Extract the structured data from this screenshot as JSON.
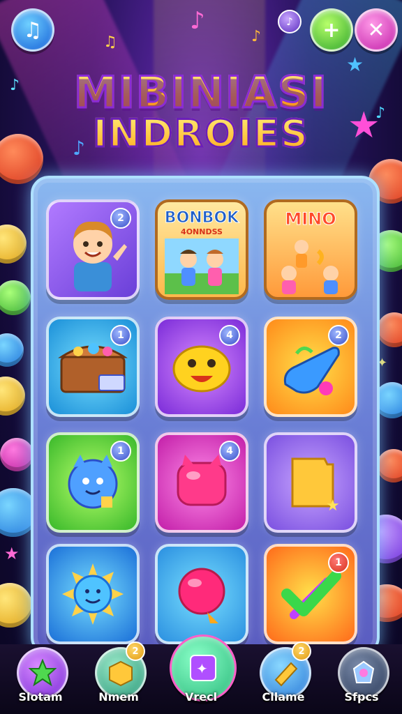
{
  "header": {
    "title_line1": "MIBINIASI",
    "title_line2": "INDROIES",
    "buttons": {
      "music_icon": "music-note-icon",
      "mini_icon": "music-note-icon",
      "plus_icon": "plus-icon",
      "close_icon": "close-icon",
      "music_glyph": "♫",
      "mini_glyph": "♪",
      "plus_glyph": "+",
      "close_glyph": "✕"
    }
  },
  "grid": {
    "tiles": [
      {
        "id": "boy",
        "badge": "2",
        "icon": "boy-character-icon"
      },
      {
        "id": "bonbok",
        "title": "BONBOK",
        "subtitle": "4ONNDSS",
        "icon": "friends-scene-icon"
      },
      {
        "id": "mino",
        "title": "MINO",
        "icon": "kids-scene-icon"
      },
      {
        "id": "treasure",
        "badge": "1",
        "icon": "treasure-chest-icon"
      },
      {
        "id": "blob",
        "badge": "4",
        "icon": "yellow-blob-icon"
      },
      {
        "id": "rocket",
        "badge": "2",
        "icon": "blue-rocket-icon"
      },
      {
        "id": "bird",
        "badge": "1",
        "icon": "blue-bird-icon"
      },
      {
        "id": "jelly",
        "badge": "4",
        "icon": "pink-jelly-icon"
      },
      {
        "id": "ticket",
        "icon": "gold-ticket-icon"
      },
      {
        "id": "sun",
        "icon": "smiling-sun-icon"
      },
      {
        "id": "balloon",
        "icon": "pink-balloon-icon"
      },
      {
        "id": "check",
        "badge": "1",
        "icon": "check-mark-icon"
      }
    ]
  },
  "nav": {
    "items": [
      {
        "label": "Slotam",
        "icon": "green-star-icon"
      },
      {
        "label": "Nmem",
        "icon": "gold-cube-icon",
        "badge": "2"
      },
      {
        "label": "Vrecl",
        "icon": "purple-card-icon"
      },
      {
        "label": "Cllame",
        "icon": "gold-ticket-icon",
        "badge": "2"
      },
      {
        "label": "Sfpcs",
        "icon": "blue-gem-icon"
      }
    ]
  },
  "colors": {
    "background": "#2a1460",
    "panel": "#6a7fd6",
    "title_fill": "#ffb21f",
    "title_stroke": "#8a2bd6"
  }
}
